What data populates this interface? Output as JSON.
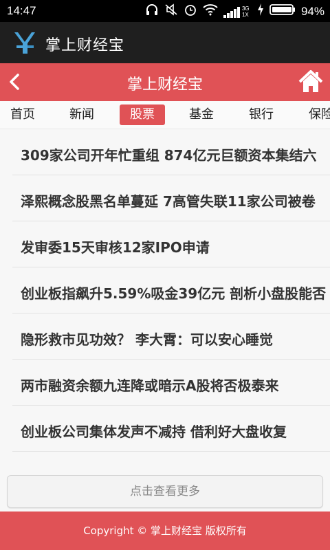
{
  "status_bar": {
    "time": "14:47",
    "network": "3G 1X",
    "battery_percent": "94%",
    "icons": [
      "headphones-icon",
      "mute-icon",
      "alarm-icon",
      "wifi-icon",
      "signal-icon",
      "charging-icon",
      "battery-icon"
    ]
  },
  "app": {
    "title": "掌上财经宝"
  },
  "header": {
    "title": "掌上财经宝"
  },
  "tabs": [
    {
      "label": "首页"
    },
    {
      "label": "新闻"
    },
    {
      "label": "股票",
      "active": true
    },
    {
      "label": "基金"
    },
    {
      "label": "银行"
    },
    {
      "label": "保险"
    }
  ],
  "news": [
    {
      "title": "309家公司开年忙重组 874亿元巨额资本集结六"
    },
    {
      "title": "泽熙概念股黑名单蔓延 7高管失联11家公司被卷"
    },
    {
      "title": "发审委15天审核12家IPO申请"
    },
    {
      "title": "创业板指飙升5.59%吸金39亿元 剖析小盘股能否"
    },
    {
      "title": "隐形救市见功效？ 李大霄：可以安心睡觉"
    },
    {
      "title": "两市融资余额九连降或暗示A股将否极泰来"
    },
    {
      "title": "创业板公司集体发声不减持 借利好大盘收复"
    }
  ],
  "more_button": {
    "label": "点击查看更多"
  },
  "footer": {
    "copyright": "Copyright © 掌上财经宝 版权所有"
  },
  "colors": {
    "accent": "#e05256",
    "titlebar": "#1f1f1f",
    "logo": "#4aa3d8"
  }
}
